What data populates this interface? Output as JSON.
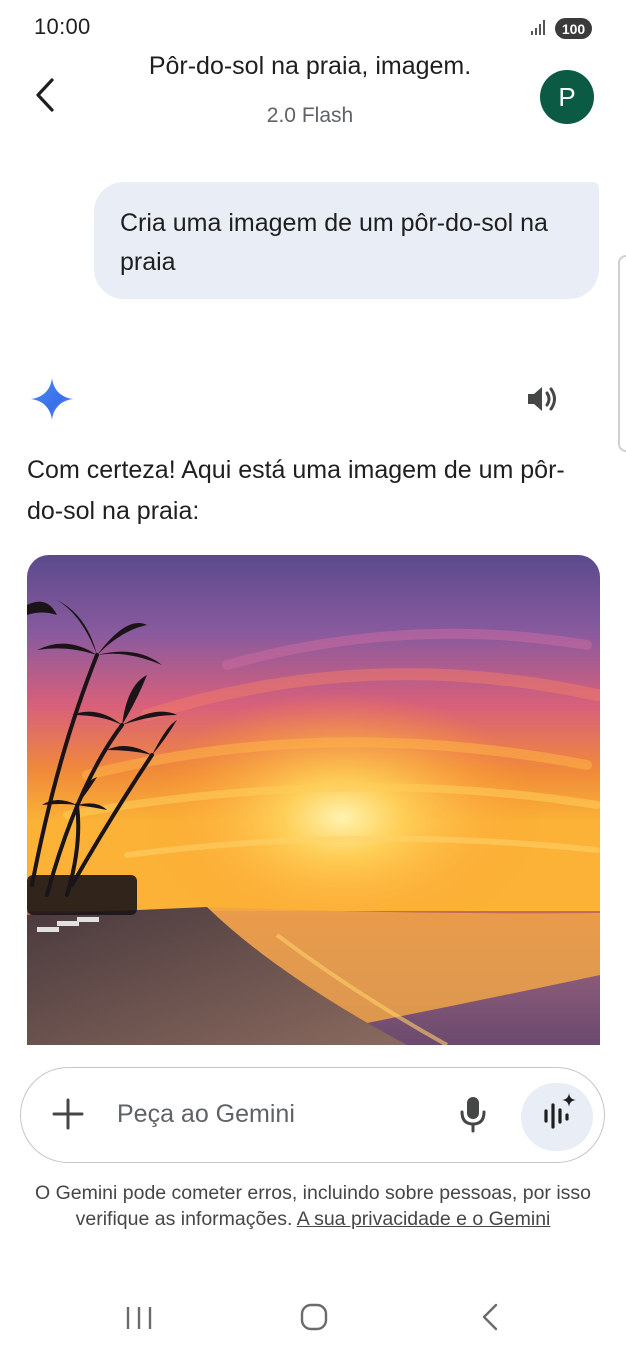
{
  "status_bar": {
    "time": "10:00",
    "battery": "100"
  },
  "header": {
    "title": "Pôr-do-sol na praia, imagem.",
    "subtitle": "2.0 Flash",
    "avatar_letter": "P"
  },
  "chat": {
    "user_message": "Cria uma imagem de um pôr-do-sol na praia",
    "response_text": "Com certeza! Aqui está uma imagem de um pôr-do-sol na praia:"
  },
  "input": {
    "placeholder": "Peça ao Gemini"
  },
  "disclaimer": {
    "text": "O Gemini pode cometer erros, incluindo sobre pessoas, por isso verifique as informações.",
    "link": "A sua privacidade e o Gemini"
  },
  "colors": {
    "avatar": "#0b5a43",
    "bubble": "#e9eef6",
    "accent_blue": "#4285f4"
  },
  "icons": [
    "back-arrow",
    "sparkle",
    "speaker",
    "plus",
    "microphone",
    "live-waveform",
    "nav-recents",
    "nav-home",
    "nav-back"
  ]
}
